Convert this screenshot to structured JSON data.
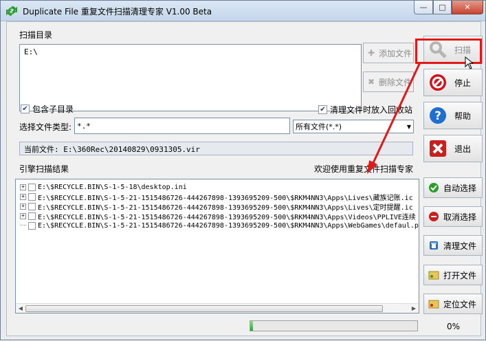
{
  "window": {
    "title": "Duplicate File 重复文件扫描清理专家 V1.00 Beta",
    "min_label": "—",
    "max_label": "□",
    "close_label": "✕"
  },
  "scan_dir": {
    "label": "扫描目录",
    "value": "E:\\",
    "add_button": "添加文件",
    "remove_button": "删除文件"
  },
  "options": {
    "include_subdirs_label": "包含子目录",
    "include_subdirs_checked": true,
    "recycle_label": "清理文件时放入回收站",
    "recycle_checked": true,
    "filetype_label": "选择文件类型:",
    "filetype_value": "*.*",
    "filetype_select": "所有文件(*.*)"
  },
  "current_file": {
    "label": "当前文件:",
    "value": "E:\\360Rec\\20140829\\0931305.vir"
  },
  "results": {
    "label": "引擎扫描结果",
    "welcome": "欢迎使用重复文件扫描专家",
    "rows": [
      "E:\\$RECYCLE.BIN\\S-1-5-18\\desktop.ini",
      "E:\\$RECYCLE.BIN\\S-1-5-21-1515486726-444267898-1393695209-500\\$RKM4NN3\\Apps\\Lives\\藏族记账.ic",
      "E:\\$RECYCLE.BIN\\S-1-5-21-1515486726-444267898-1393695209-500\\$RKM4NN3\\Apps\\Lives\\定时提醒.ic",
      "E:\\$RECYCLE.BIN\\S-1-5-21-1515486726-444267898-1393695209-500\\$RKM4NN3\\Apps\\Videos\\PPLIVE连续",
      "E:\\$RECYCLE.BIN\\S-1-5-21-1515486726-444267898-1393695209-500\\$RKM4NN3\\Apps\\WebGames\\defaul.p"
    ]
  },
  "buttons": {
    "scan": "扫描",
    "stop": "停止",
    "help": "帮助",
    "exit": "退出",
    "auto_select": "自动选择",
    "cancel_select": "取消选择",
    "clean_files": "清理文件",
    "open_file": "打开文件",
    "locate_file": "定位文件"
  },
  "progress": {
    "fraction": 0.0,
    "label": "0%"
  },
  "colors": {
    "highlight": "#e01818",
    "stop": "#d0141c",
    "help": "#1f6fd0",
    "exit": "#c8201e",
    "progress": "#1fae2a"
  }
}
